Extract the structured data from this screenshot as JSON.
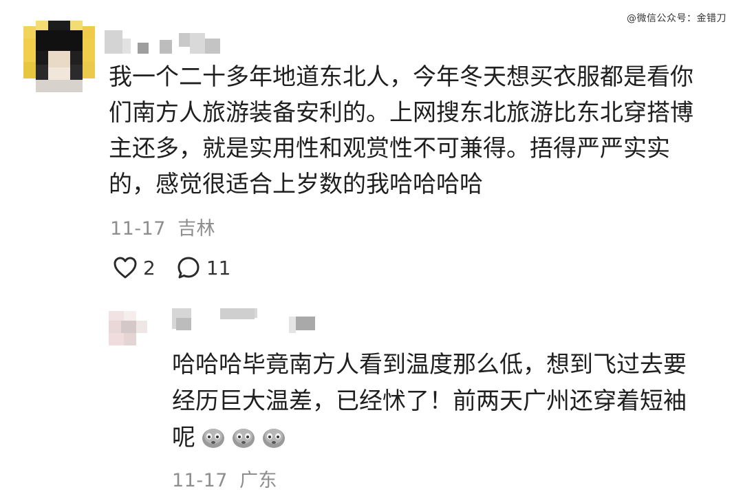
{
  "watermark": "@微信公众号：金错刀",
  "comment": {
    "text": "我一个二十多年地道东北人，今年冬天想买衣服都是看你们南方人旅游装备安利的。上网搜东北旅游比东北穿搭博主还多，就是实用性和观赏性不可兼得。捂得严严实实的，感觉很适合上岁数的我哈哈哈哈",
    "date": "11-17",
    "location": "吉林",
    "likes": "2",
    "replies": "11"
  },
  "reply": {
    "text": "哈哈哈毕竟南方人看到温度那么低，想到飞过去要经历巨大温差，已经怵了！前两天广州还穿着短袖呢",
    "emoji_name": "pensive-face-emoji",
    "emoji_count": 3,
    "date": "11-17",
    "location": "广东"
  }
}
